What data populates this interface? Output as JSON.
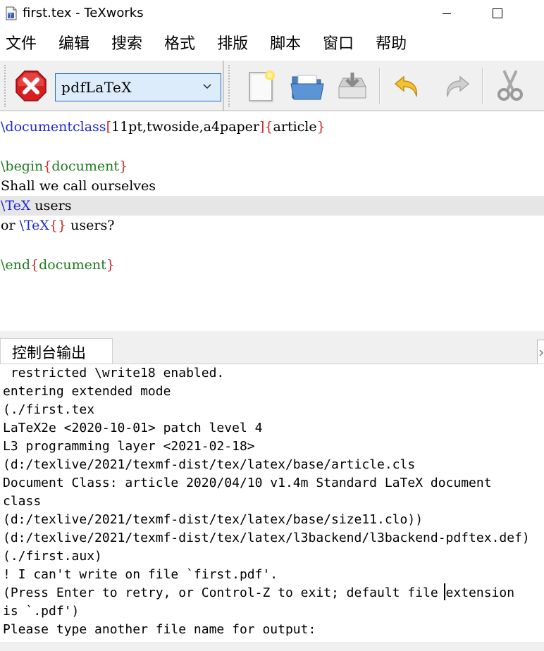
{
  "window": {
    "title": "first.tex - TeXworks",
    "icon": "tex-document-icon"
  },
  "menu": {
    "items": [
      {
        "label": "文件"
      },
      {
        "label": "编辑"
      },
      {
        "label": "搜索"
      },
      {
        "label": "格式"
      },
      {
        "label": "排版"
      },
      {
        "label": "脚本"
      },
      {
        "label": "窗口"
      },
      {
        "label": "帮助"
      }
    ]
  },
  "toolbar": {
    "stop_icon": "stop-typeset-icon",
    "engine": "pdfLaTeX",
    "new_icon": "new-document-icon",
    "open_icon": "open-folder-icon",
    "save_icon": "save-icon",
    "undo_icon": "undo-icon",
    "redo_icon": "redo-icon",
    "cut_icon": "cut-icon"
  },
  "editor": {
    "current_line": 4,
    "lines": [
      "\\documentclass[11pt,twoside,a4paper]{article}",
      "",
      "\\begin{document}",
      "Shall we call ourselves",
      "\\TeX users",
      "or \\TeX{} users?",
      "",
      "\\end{document}"
    ]
  },
  "console": {
    "tab_label": "控制台输出",
    "lines": [
      " restricted \\write18 enabled.",
      "entering extended mode",
      "(./first.tex",
      "LaTeX2e <2020-10-01> patch level 4",
      "L3 programming layer <2021-02-18>",
      "(d:/texlive/2021/texmf-dist/tex/latex/base/article.cls",
      "Document Class: article 2020/04/10 v1.4m Standard LaTeX document",
      "class",
      "(d:/texlive/2021/texmf-dist/tex/latex/base/size11.clo))",
      "(d:/texlive/2021/texmf-dist/tex/latex/l3backend/l3backend-pdftex.def)",
      "(./first.aux)",
      "! I can't write on file `first.pdf'.",
      "(Press Enter to retry, or Control-Z to exit; default file extension",
      "is `.pdf')",
      "Please type another file name for output:"
    ]
  },
  "colors": {
    "command": "#1e2bd6",
    "bracket": "#cc2a2a",
    "argument": "#1f7a1f",
    "current_line_bg": "#e6e6e6",
    "stop_red": "#e02020"
  }
}
